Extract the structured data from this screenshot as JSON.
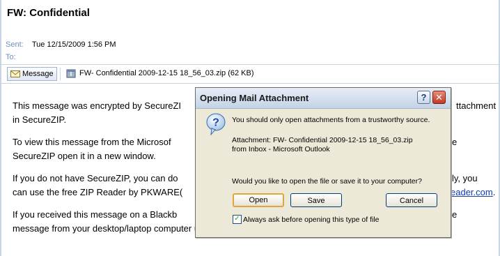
{
  "message": {
    "subject": "FW: Confidential",
    "sent_label": "Sent:",
    "sent_value": "Tue 12/15/2009 1:56 PM",
    "to_label": "To:",
    "to_value": ""
  },
  "attachment_bar": {
    "message_tab": "Message",
    "attachment_label": "FW- Confidential 2009-12-15 18_56_03.zip (62 KB)"
  },
  "body": {
    "p1_line1": "This message was encrypted by SecureZI",
    "p1_line1_right": "ttachment",
    "p1_line2": "in SecureZIP.",
    "p2_line1": "To view this message from the Microsof",
    "p2_line1_right": "e",
    "p2_line2": "SecureZIP open it in a new window.",
    "p3_line1": "If you do not have SecureZIP, you can do",
    "p3_line1_right": "ly, you",
    "p3_line2": "can use the free ZIP Reader by PKWARE(",
    "p3_line2_link": "eader.com",
    "p3_line2_end": ".",
    "p4_line1": "If you received this message on a Blackb",
    "p4_line1_right": "e",
    "p4_line2": "message from your desktop/laptop computer using SecureZIP."
  },
  "dialog": {
    "title": "Opening Mail Attachment",
    "warning": "You should only open attachments from a trustworthy source.",
    "attachment_line": "Attachment: FW- Confidential 2009-12-15 18_56_03.zip",
    "source_line": "from Inbox - Microsoft Outlook",
    "question": "Would you like to open the file or save it to your computer?",
    "open_label": "Open",
    "save_label": "Save",
    "cancel_label": "Cancel",
    "checkbox_label": "Always ask before opening this type of file",
    "checkbox_checked": "✓",
    "help_glyph": "?",
    "close_glyph": "✕"
  }
}
